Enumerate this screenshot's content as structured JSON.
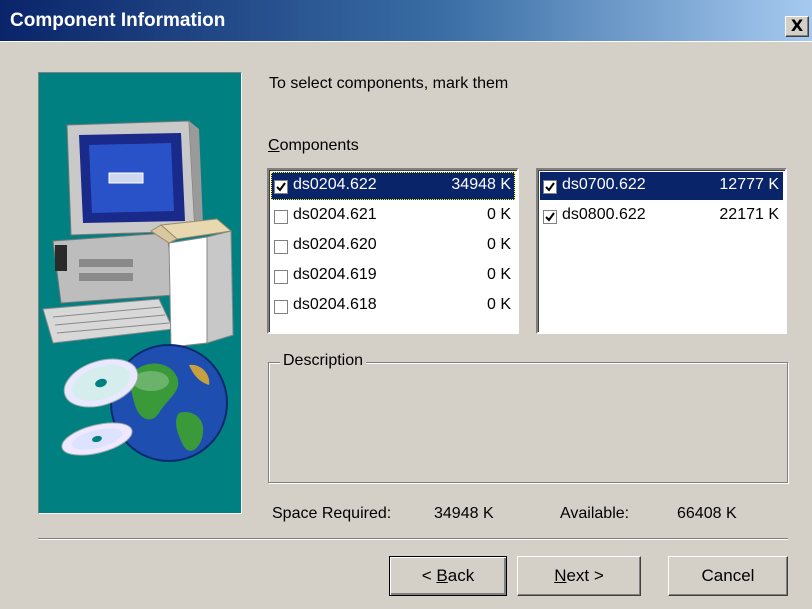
{
  "window": {
    "title": "Component Information",
    "close_glyph": "X"
  },
  "main": {
    "instruction": "To select components, mark them",
    "components_label_accel": "C",
    "components_label_rest": "omponents",
    "description_label": "Description",
    "description_text": ""
  },
  "left_list": {
    "items": [
      {
        "name": "ds0204.622",
        "size": "34948 K",
        "checked": true,
        "selected": true
      },
      {
        "name": "ds0204.621",
        "size": "0 K",
        "checked": false,
        "selected": false
      },
      {
        "name": "ds0204.620",
        "size": "0 K",
        "checked": false,
        "selected": false
      },
      {
        "name": "ds0204.619",
        "size": "0 K",
        "checked": false,
        "selected": false
      },
      {
        "name": "ds0204.618",
        "size": "0 K",
        "checked": false,
        "selected": false
      }
    ]
  },
  "right_list": {
    "items": [
      {
        "name": "ds0700.622",
        "size": "12777 K",
        "checked": true,
        "selected": true
      },
      {
        "name": "ds0800.622",
        "size": "22171 K",
        "checked": true,
        "selected": false
      }
    ]
  },
  "space": {
    "required_label": "Space Required:",
    "required_value": "34948 K",
    "available_label": "Available:",
    "available_value": "66408 K"
  },
  "buttons": {
    "back_prefix": "< ",
    "back_accel": "B",
    "back_rest": "ack",
    "next_accel": "N",
    "next_rest": "ext >",
    "cancel": "Cancel"
  },
  "icons": {
    "close": "close-icon",
    "checkbox": "checkbox-checked-icon",
    "illustration": "computer-with-cds-and-globe-illustration"
  },
  "colors": {
    "title_start": "#0a246a",
    "title_end": "#a6caf0",
    "art_background": "#008080",
    "selection": "#0a246a",
    "face": "#d4d0c8"
  }
}
